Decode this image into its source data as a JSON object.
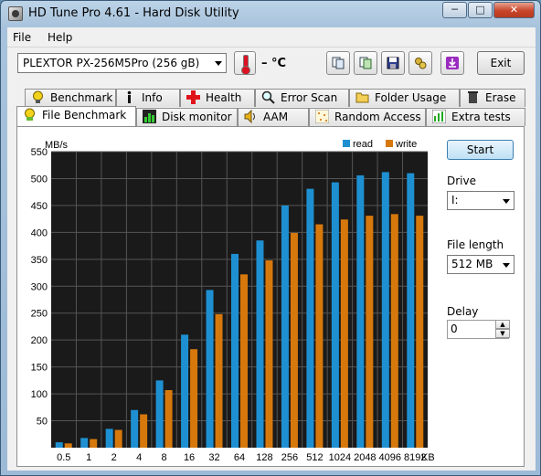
{
  "window": {
    "title": "HD Tune Pro 4.61 - Hard Disk Utility",
    "minimize": "─",
    "maximize": "□",
    "close": "✕"
  },
  "menu": {
    "file": "File",
    "help": "Help"
  },
  "toolbar": {
    "drive": "PLEXTOR PX-256M5Pro (256 gB)",
    "temperature": "– °C",
    "exit_label": "Exit",
    "icons": [
      "copy-icon",
      "copy-screenshot-icon",
      "save-icon",
      "options-icon",
      "download-icon"
    ]
  },
  "tabs_top": [
    "Benchmark",
    "Info",
    "Health",
    "Error Scan",
    "Folder Usage",
    "Erase"
  ],
  "tabs_bottom": [
    "File Benchmark",
    "Disk monitor",
    "AAM",
    "Random Access",
    "Extra tests"
  ],
  "active_tab": "File Benchmark",
  "side": {
    "start_label": "Start",
    "drive_label": "Drive",
    "drive_value": "I:",
    "file_length_label": "File length",
    "file_length_value": "512 MB",
    "delay_label": "Delay",
    "delay_value": "0"
  },
  "colors": {
    "read": "#1e90d2",
    "write": "#d6780c",
    "chart_bg": "#1a1a1a",
    "grid": "#555555"
  },
  "chart_data": {
    "type": "bar",
    "ylabel": "MB/s",
    "x_unit": "KB",
    "ylim": [
      0,
      550
    ],
    "yticks": [
      50,
      100,
      150,
      200,
      250,
      300,
      350,
      400,
      450,
      500,
      550
    ],
    "categories": [
      "0.5",
      "1",
      "2",
      "4",
      "8",
      "16",
      "32",
      "64",
      "128",
      "256",
      "512",
      "1024",
      "2048",
      "4096",
      "8192"
    ],
    "legend_position": "top-right",
    "series": [
      {
        "name": "read",
        "values": [
          10,
          18,
          35,
          70,
          125,
          210,
          293,
          360,
          385,
          450,
          481,
          493,
          506,
          512,
          510
        ]
      },
      {
        "name": "write",
        "values": [
          8,
          16,
          33,
          62,
          107,
          183,
          248,
          322,
          348,
          399,
          415,
          424,
          431,
          434,
          431
        ]
      }
    ]
  }
}
